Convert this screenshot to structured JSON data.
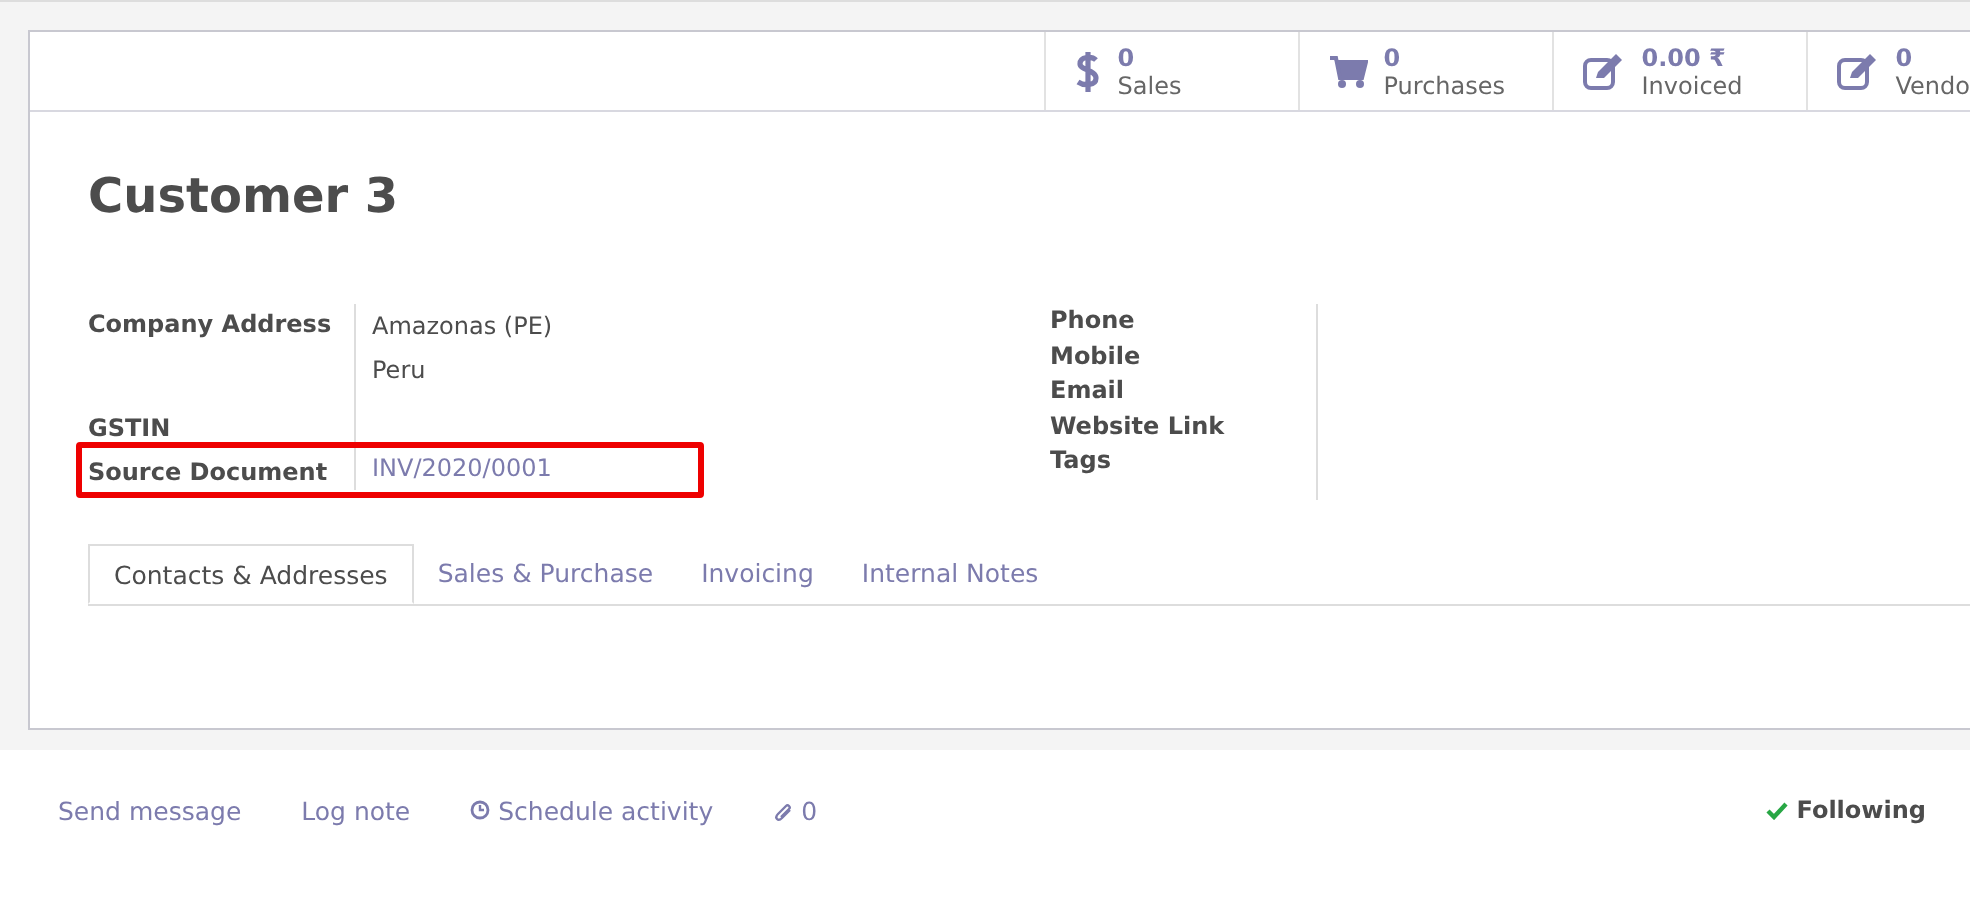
{
  "stat_buttons": [
    {
      "kind": "dollar",
      "value": "0",
      "label": "Sales"
    },
    {
      "kind": "cart",
      "value": "0",
      "label": "Purchases"
    },
    {
      "kind": "edit",
      "value": "0.00 ₹",
      "label": "Invoiced"
    },
    {
      "kind": "edit",
      "value": "0",
      "label": "Vendo"
    }
  ],
  "title": "Customer 3",
  "left_fields": [
    {
      "label": "Company Address",
      "values": [
        "Amazonas (PE)",
        "Peru"
      ],
      "highlighted": false,
      "link": false
    },
    {
      "label": "GSTIN",
      "highlighted": false
    },
    {
      "label": "Source Document",
      "values": [
        "INV/2020/0001"
      ],
      "highlighted": true,
      "link": true
    }
  ],
  "right_fields": [
    "Phone",
    "Mobile",
    "Email",
    "Website Link",
    "Tags"
  ],
  "tabs": [
    {
      "label": "Contacts & Addresses",
      "selected": true
    },
    {
      "label": "Sales & Purchase",
      "selected": false
    },
    {
      "label": "Invoicing",
      "selected": false
    },
    {
      "label": "Internal Notes",
      "selected": false
    }
  ],
  "chatter": {
    "send_message": "Send message",
    "log_note": "Log note",
    "schedule_activity": "Schedule activity",
    "attachments": "0",
    "following": "Following"
  }
}
